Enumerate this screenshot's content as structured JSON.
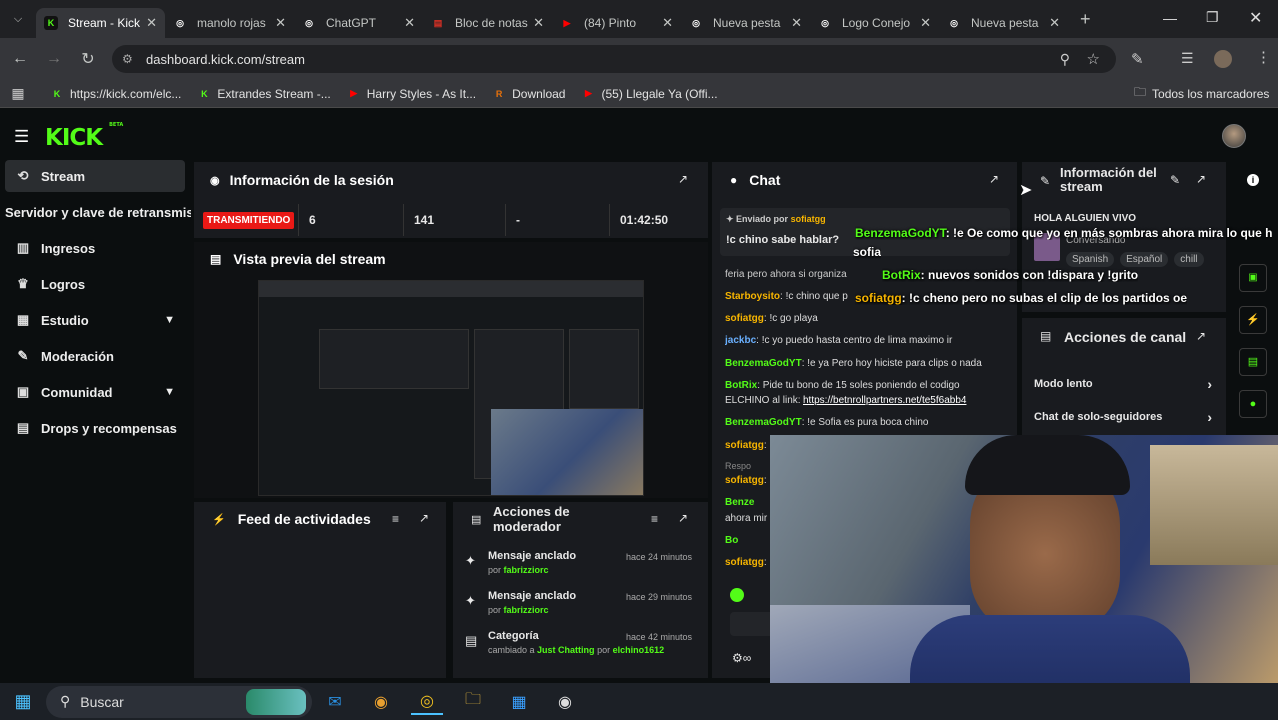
{
  "browser": {
    "tabs": [
      {
        "title": "Stream - Kick",
        "icon": "kick-icon",
        "color": "#53fc18",
        "active": true
      },
      {
        "title": "manolo rojas",
        "icon": "google-icon",
        "color": "#ffffff"
      },
      {
        "title": "ChatGPT",
        "icon": "chatgpt-icon",
        "color": "#ffffff"
      },
      {
        "title": "Bloc de notas",
        "icon": "notepad-icon",
        "color": "#d93025"
      },
      {
        "title": "(84) Pinto",
        "icon": "youtube-icon",
        "color": "#ff0000"
      },
      {
        "title": "Nueva pesta",
        "icon": "chrome-icon",
        "color": "#ffffff"
      },
      {
        "title": "Logo Conejo",
        "icon": "google-icon",
        "color": "#ffffff"
      },
      {
        "title": "Nueva pesta",
        "icon": "chrome-icon",
        "color": "#ffffff"
      }
    ],
    "url": "dashboard.kick.com/stream",
    "bookmarks": [
      {
        "label": "https://kick.com/elc...",
        "color": "#53fc18"
      },
      {
        "label": "Extrandes Stream -...",
        "color": "#53fc18"
      },
      {
        "label": "Harry Styles - As It...",
        "color": "#ff0000"
      },
      {
        "label": "Download",
        "color": "#e8710a"
      },
      {
        "label": "(55) Llegale Ya (Offi...",
        "color": "#ff0000"
      }
    ],
    "all_bookmarks": "Todos los marcadores"
  },
  "app": {
    "logo": "KICK",
    "logo_badge": "BETA",
    "sidebar": [
      {
        "label": "Stream",
        "icon": "broadcast-icon",
        "active": true
      },
      {
        "label": "Servidor y clave de retransmisión",
        "icon": ""
      },
      {
        "label": "Ingresos",
        "icon": "chart-icon"
      },
      {
        "label": "Logros",
        "icon": "trophy-icon"
      },
      {
        "label": "Estudio",
        "icon": "studio-icon",
        "chevron": true
      },
      {
        "label": "Moderación",
        "icon": "wrench-icon"
      },
      {
        "label": "Comunidad",
        "icon": "community-icon",
        "chevron": true
      },
      {
        "label": "Drops y recompensas",
        "icon": "drops-icon"
      }
    ],
    "session": {
      "title": "Información de la sesión",
      "live_badge": "TRANSMITIENDO",
      "stats": [
        "6",
        "141",
        "-",
        "01:42:50"
      ]
    },
    "preview": {
      "title": "Vista previa del stream"
    },
    "activity": {
      "title": "Feed de actividades"
    },
    "mod_actions": {
      "title": "Acciones de moderador",
      "items": [
        {
          "action": "Mensaje anclado",
          "prefix": "por",
          "user": "fabrizziorc",
          "time": "hace 24 minutos"
        },
        {
          "action": "Mensaje anclado",
          "prefix": "por",
          "user": "fabrizziorc",
          "time": "hace 29 minutos"
        },
        {
          "action": "Categoría",
          "prefix": "cambiado a",
          "user": "Just Chatting",
          "by": "por",
          "user2": "elchino1612",
          "time": "hace 42 minutos"
        }
      ]
    },
    "chat": {
      "title": "Chat",
      "pinned_label": "Enviado por",
      "pinned_user": "sofiatgg",
      "pinned_msg": "!c chino sabe hablar?",
      "messages": [
        {
          "user": "Starboysito",
          "text": ": !c chino que p"
        },
        {
          "user": "sofiatgg",
          "text": ": !c go playa"
        },
        {
          "user": "jackbc",
          "text": ": !c yo puedo hasta centro de lima maximo ir"
        },
        {
          "user": "BenzemaGodYT",
          "text": ": !e ya Pero hoy hiciste para clips o nada"
        },
        {
          "user": "BotRix",
          "text": ": Pide tu bono de 15 soles poniendo el codigo"
        },
        {
          "user": "",
          "text": "ELCHINO al link:"
        },
        {
          "user": "",
          "text": "https://betnrollpartners.net/te5f6abb4"
        },
        {
          "user": "BenzemaGodYT",
          "text": ": !e Sofia es pura boca chino"
        },
        {
          "user": "sofiatgg",
          "text": ":"
        },
        {
          "user": "",
          "text": "Respo"
        },
        {
          "user": "sofiatgg",
          "text": ":"
        },
        {
          "user": "Benze",
          "text": ""
        },
        {
          "user": "",
          "text": "ahora mir"
        },
        {
          "user": "Bo",
          "text": ""
        },
        {
          "user": "sofiatgg",
          "text": ":"
        }
      ],
      "partial_text": "feria pero ahora si organiza"
    },
    "overlay_chat": [
      {
        "user": "BenzemaGodYT",
        "text": ": !e Oe como que yo en más sombras ahora mira lo que h"
      },
      {
        "user": "",
        "text": "sofia"
      },
      {
        "user": "BotRix",
        "text": ": nuevos sonidos con !dispara y !grito"
      },
      {
        "user": "sofiatgg",
        "text": ": !c cheno pero no subas el clip de los partidos oe"
      }
    ],
    "stream_info": {
      "title": "Información del stream",
      "stream_title": "HOLA ALGUIEN VIVO",
      "category": "Conversando",
      "tags": [
        "Spanish",
        "Español",
        "chill"
      ]
    },
    "channel_actions": {
      "title": "Acciones de canal",
      "items": [
        "Modo lento",
        "Chat de solo-seguidores"
      ]
    }
  },
  "taskbar": {
    "search": "Buscar"
  }
}
